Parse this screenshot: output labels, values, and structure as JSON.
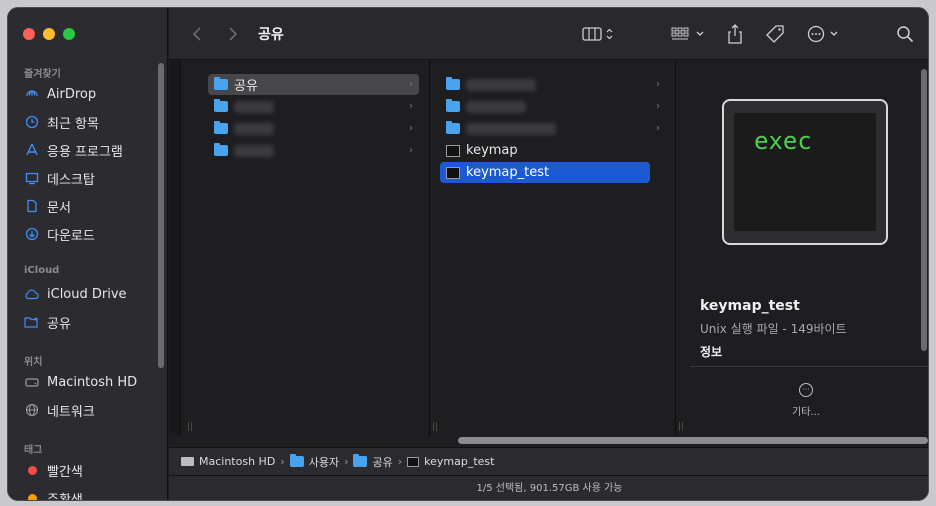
{
  "window": {
    "title": "공유"
  },
  "sidebar": {
    "sections": [
      {
        "label": "즐겨찾기"
      },
      {
        "label": "iCloud"
      },
      {
        "label": "위치"
      },
      {
        "label": "태그"
      }
    ],
    "favorites": [
      {
        "label": "AirDrop",
        "icon": "airdrop-icon"
      },
      {
        "label": "최근 항목",
        "icon": "clock-icon"
      },
      {
        "label": "응용 프로그램",
        "icon": "applications-icon"
      },
      {
        "label": "데스크탑",
        "icon": "desktop-icon"
      },
      {
        "label": "문서",
        "icon": "document-icon"
      },
      {
        "label": "다운로드",
        "icon": "download-icon"
      }
    ],
    "icloud": [
      {
        "label": "iCloud Drive",
        "icon": "cloud-icon"
      },
      {
        "label": "공유",
        "icon": "shared-folder-icon"
      }
    ],
    "locations": [
      {
        "label": "Macintosh HD",
        "icon": "harddisk-icon"
      },
      {
        "label": "네트워크",
        "icon": "network-icon"
      }
    ],
    "tags": [
      {
        "label": "빨간색",
        "color": "#fe4a49"
      },
      {
        "label": "주황색",
        "color": "#fe9d0a"
      }
    ]
  },
  "toolbar": {
    "back_icon": "chevron-left-icon",
    "forward_icon": "chevron-right-icon",
    "view_icon": "column-view-icon",
    "group_icon": "group-grid-icon",
    "share_icon": "share-icon",
    "tag_icon": "tag-icon",
    "more_icon": "ellipsis-circle-icon",
    "search_icon": "search-icon"
  },
  "columns": {
    "col1": [
      {
        "label": "공유",
        "type": "folder",
        "selected": true
      },
      {
        "label": "",
        "type": "folder-blurred"
      },
      {
        "label": "",
        "type": "folder-blurred"
      },
      {
        "label": "",
        "type": "folder-blurred"
      }
    ],
    "col2": [
      {
        "label": "",
        "type": "folder-blurred"
      },
      {
        "label": "",
        "type": "folder-blurred"
      },
      {
        "label": "",
        "type": "folder-blurred"
      },
      {
        "label": "keymap",
        "type": "exec"
      },
      {
        "label": "keymap_test",
        "type": "exec",
        "selected": true
      }
    ]
  },
  "preview": {
    "icon_text": "exec",
    "name": "keymap_test",
    "kind": "Unix 실행 파일 - 149바이트",
    "info_label": "정보",
    "more_label": "기타..."
  },
  "pathbar": {
    "items": [
      "Macintosh HD",
      "사용자",
      "공유",
      "keymap_test"
    ],
    "separator": "›"
  },
  "status": {
    "text": "1/5 선택됨, 901.57GB 사용 가능"
  }
}
